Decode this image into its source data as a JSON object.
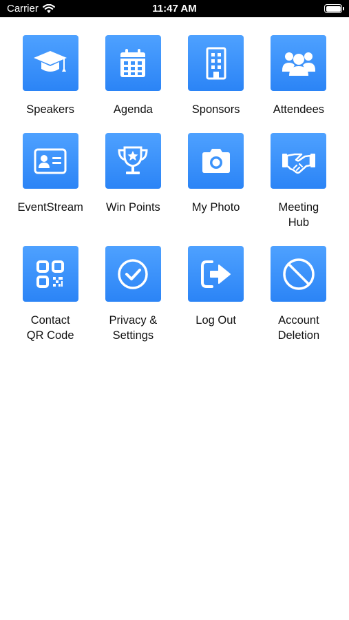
{
  "status_bar": {
    "carrier": "Carrier",
    "time": "11:47 AM",
    "wifi_icon": "wifi-icon",
    "battery_icon": "battery-icon"
  },
  "theme": {
    "tile_color": "#3b93fb",
    "status_bar_bg": "#000000",
    "background": "#ffffff"
  },
  "tiles": [
    {
      "label": "Speakers",
      "icon": "graduation-cap-icon"
    },
    {
      "label": "Agenda",
      "icon": "calendar-icon"
    },
    {
      "label": "Sponsors",
      "icon": "building-icon"
    },
    {
      "label": "Attendees",
      "icon": "users-icon"
    },
    {
      "label": "EventStream",
      "icon": "id-card-icon"
    },
    {
      "label": "Win Points",
      "icon": "trophy-icon"
    },
    {
      "label": "My Photo",
      "icon": "camera-icon"
    },
    {
      "label": "Meeting\nHub",
      "icon": "handshake-icon"
    },
    {
      "label": "Contact\nQR Code",
      "icon": "qr-code-icon"
    },
    {
      "label": "Privacy &\nSettings",
      "icon": "check-circle-icon"
    },
    {
      "label": "Log Out",
      "icon": "sign-out-icon"
    },
    {
      "label": "Account\nDeletion",
      "icon": "ban-icon"
    }
  ]
}
